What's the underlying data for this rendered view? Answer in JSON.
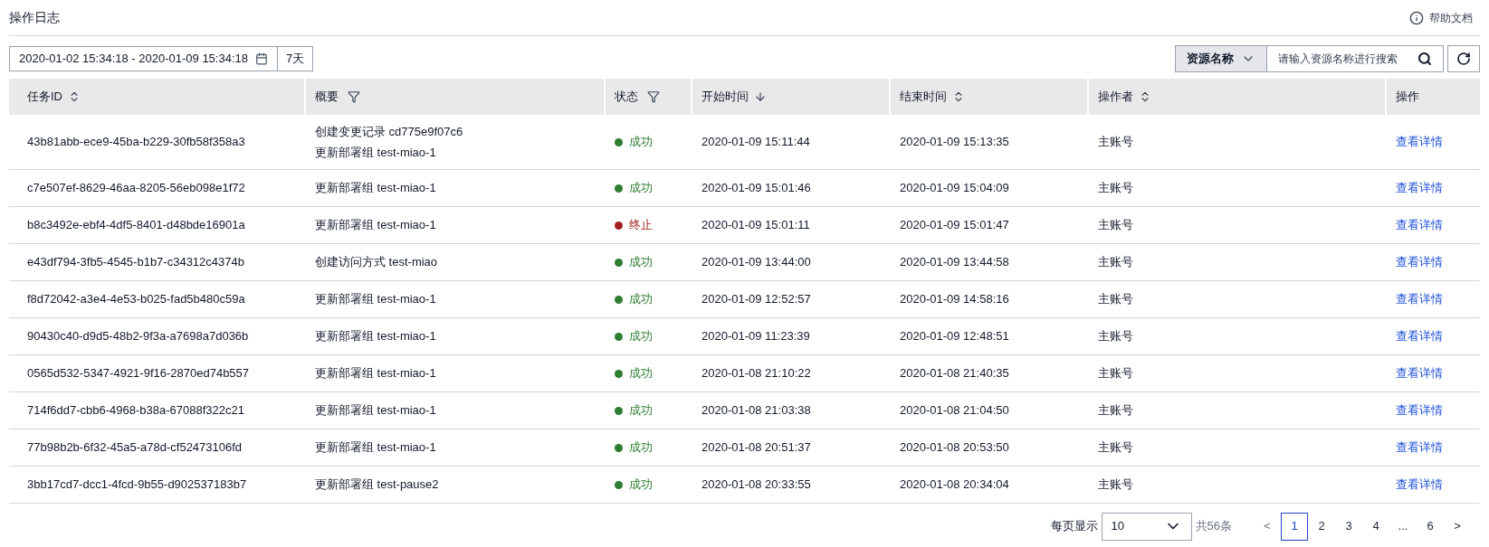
{
  "page": {
    "title": "操作日志",
    "help_link": "帮助文档"
  },
  "toolbar": {
    "date_range": "2020-01-02 15:34:18 - 2020-01-09 15:34:18",
    "quick_range": "7天",
    "search_scope": "资源名称",
    "search": {
      "placeholder": "请输入资源名称进行搜索"
    }
  },
  "table": {
    "columns": [
      {
        "label": "任务ID",
        "kind": "sort"
      },
      {
        "label": "概要",
        "kind": "filter"
      },
      {
        "label": "状态",
        "kind": "filter"
      },
      {
        "label": "开始时间",
        "kind": "sort-desc"
      },
      {
        "label": "结束时间",
        "kind": "sort"
      },
      {
        "label": "操作者",
        "kind": "sort"
      },
      {
        "label": "操作",
        "kind": "plain"
      }
    ],
    "rows": [
      {
        "task_id": "43b81abb-ece9-45ba-b229-30fb58f358a3",
        "summary": [
          "创建变更记录 cd775e9f07c6",
          "更新部署组 test-miao-1"
        ],
        "status": "成功",
        "color": "#2e7d32",
        "start": "2020-01-09 15:11:44",
        "end": "2020-01-09 15:13:35",
        "operator": "主账号",
        "action": "查看详情"
      },
      {
        "task_id": "c7e507ef-8629-46aa-8205-56eb098e1f72",
        "summary": [
          "更新部署组 test-miao-1"
        ],
        "status": "成功",
        "color": "#2e7d32",
        "start": "2020-01-09 15:01:46",
        "end": "2020-01-09 15:04:09",
        "operator": "主账号",
        "action": "查看详情"
      },
      {
        "task_id": "b8c3492e-ebf4-4df5-8401-d48bde16901a",
        "summary": [
          "更新部署组 test-miao-1"
        ],
        "status": "终止",
        "color": "#a12222",
        "start": "2020-01-09 15:01:11",
        "end": "2020-01-09 15:01:47",
        "operator": "主账号",
        "action": "查看详情"
      },
      {
        "task_id": "e43df794-3fb5-4545-b1b7-c34312c4374b",
        "summary": [
          "创建访问方式 test-miao"
        ],
        "status": "成功",
        "color": "#2e7d32",
        "start": "2020-01-09 13:44:00",
        "end": "2020-01-09 13:44:58",
        "operator": "主账号",
        "action": "查看详情"
      },
      {
        "task_id": "f8d72042-a3e4-4e53-b025-fad5b480c59a",
        "summary": [
          "更新部署组 test-miao-1"
        ],
        "status": "成功",
        "color": "#2e7d32",
        "start": "2020-01-09 12:52:57",
        "end": "2020-01-09 14:58:16",
        "operator": "主账号",
        "action": "查看详情"
      },
      {
        "task_id": "90430c40-d9d5-48b2-9f3a-a7698a7d036b",
        "summary": [
          "更新部署组 test-miao-1"
        ],
        "status": "成功",
        "color": "#2e7d32",
        "start": "2020-01-09 11:23:39",
        "end": "2020-01-09 12:48:51",
        "operator": "主账号",
        "action": "查看详情"
      },
      {
        "task_id": "0565d532-5347-4921-9f16-2870ed74b557",
        "summary": [
          "更新部署组 test-miao-1"
        ],
        "status": "成功",
        "color": "#2e7d32",
        "start": "2020-01-08 21:10:22",
        "end": "2020-01-08 21:40:35",
        "operator": "主账号",
        "action": "查看详情"
      },
      {
        "task_id": "714f6dd7-cbb6-4968-b38a-67088f322c21",
        "summary": [
          "更新部署组 test-miao-1"
        ],
        "status": "成功",
        "color": "#2e7d32",
        "start": "2020-01-08 21:03:38",
        "end": "2020-01-08 21:04:50",
        "operator": "主账号",
        "action": "查看详情"
      },
      {
        "task_id": "77b98b2b-6f32-45a5-a78d-cf52473106fd",
        "summary": [
          "更新部署组 test-miao-1"
        ],
        "status": "成功",
        "color": "#2e7d32",
        "start": "2020-01-08 20:51:37",
        "end": "2020-01-08 20:53:50",
        "operator": "主账号",
        "action": "查看详情"
      },
      {
        "task_id": "3bb17cd7-dcc1-4fcd-9b55-d902537183b7",
        "summary": [
          "更新部署组 test-pause2"
        ],
        "status": "成功",
        "color": "#2e7d32",
        "start": "2020-01-08 20:33:55",
        "end": "2020-01-08 20:34:04",
        "operator": "主账号",
        "action": "查看详情"
      }
    ]
  },
  "pagination": {
    "page_size_label": "每页显示",
    "page_size": "10",
    "total": "共56条",
    "prev": "<",
    "pages": [
      {
        "label": "1",
        "selected": true
      },
      {
        "label": "2",
        "selected": false
      },
      {
        "label": "3",
        "selected": false
      },
      {
        "label": "4",
        "selected": false
      },
      {
        "label": "...",
        "selected": false
      },
      {
        "label": "6",
        "selected": false
      }
    ],
    "next": ">"
  }
}
